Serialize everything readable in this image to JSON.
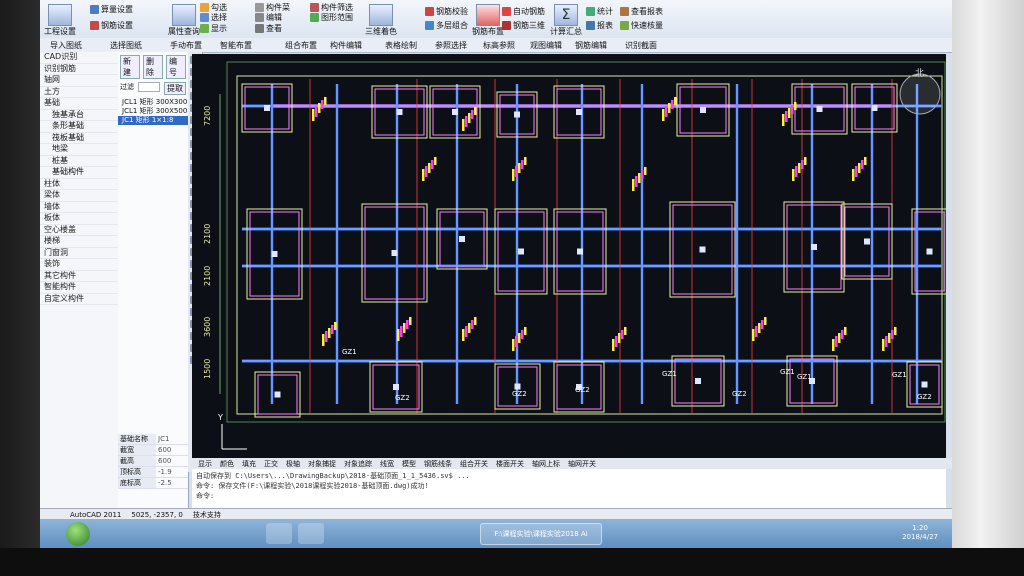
{
  "ribbon": {
    "big_buttons": [
      {
        "label": "工程设置",
        "icon": "project-settings-icon"
      },
      {
        "label": "属性查询",
        "icon": "property-query-icon"
      },
      {
        "label": "三维着色",
        "icon": "3d-shade-icon"
      },
      {
        "label": "钢筋布置",
        "icon": "rebar-place-icon"
      },
      {
        "label": "计算汇总",
        "icon": "sigma-icon"
      }
    ],
    "small_buttons": [
      "算量设置",
      "钢筋设置",
      "勾选",
      "选择",
      "显示",
      "构件菜",
      "编辑",
      "查看",
      "构件筛选",
      "图形范围",
      "隐藏",
      "查询",
      "两份",
      "图层",
      "钢筋校验",
      "智能钢筋",
      "多层组合",
      "自动钢筋",
      "钢筋三维",
      "统计",
      "报表",
      "查看报表",
      "快速核量"
    ],
    "toolbar2": [
      "导入图纸",
      "选择图纸",
      "手动布置",
      "智能布置",
      "组合布置",
      "构件编辑",
      "表格绘制",
      "参照选择",
      "标高参照",
      "观图编辑",
      "钢筋编辑",
      "识别截面"
    ]
  },
  "left_panel": {
    "items": [
      {
        "label": "CAD识别",
        "type": "cat"
      },
      {
        "label": "识别钢筋",
        "type": "cat"
      },
      {
        "label": "轴网",
        "type": "cat"
      },
      {
        "label": "土方",
        "type": "cat"
      },
      {
        "label": "基础",
        "type": "cat"
      },
      {
        "label": "独基承台",
        "type": "item"
      },
      {
        "label": "条形基础",
        "type": "item"
      },
      {
        "label": "筏板基础",
        "type": "item"
      },
      {
        "label": "地梁",
        "type": "item"
      },
      {
        "label": "桩基",
        "type": "item"
      },
      {
        "label": "基础构件",
        "type": "item"
      },
      {
        "label": "柱体",
        "type": "cat"
      },
      {
        "label": "梁体",
        "type": "cat"
      },
      {
        "label": "墙体",
        "type": "cat"
      },
      {
        "label": "板体",
        "type": "cat"
      },
      {
        "label": "空心楼盖",
        "type": "cat"
      },
      {
        "label": "楼梯",
        "type": "cat"
      },
      {
        "label": "门窗洞",
        "type": "cat"
      },
      {
        "label": "装饰",
        "type": "cat"
      },
      {
        "label": "其它构件",
        "type": "cat"
      },
      {
        "label": "智能构件",
        "type": "cat"
      },
      {
        "label": "自定义构件",
        "type": "cat"
      }
    ]
  },
  "mid_panel": {
    "buttons": [
      "新建",
      "删除",
      "编号"
    ],
    "filter_label": "过滤",
    "filter_btn": "提取",
    "rows": [
      {
        "label": "JCL1 矩形 300X300",
        "selected": false
      },
      {
        "label": "JCL1 矩形 300X500",
        "selected": false
      },
      {
        "label": "JC1 矩形 1×1:8",
        "selected": true
      }
    ],
    "props": [
      {
        "k": "基础名称",
        "v": "JC1"
      },
      {
        "k": "截宽",
        "v": "600"
      },
      {
        "k": "截高",
        "v": "600"
      },
      {
        "k": "顶标高",
        "v": "-1.9"
      },
      {
        "k": "底标高",
        "v": "-2.5"
      }
    ]
  },
  "drawing": {
    "dims": [
      "7200",
      "2100",
      "2100",
      "3600",
      "1500"
    ],
    "gz_labels": [
      "GZ1",
      "GZ1",
      "GZ2",
      "GZ2",
      "GZ1",
      "GZ2",
      "GZ2",
      "GZ1",
      "GZ1",
      "GZ2"
    ],
    "compass": "北",
    "ucs": "Y"
  },
  "bottom_tabs": [
    "显示",
    "颜色",
    "填充",
    "正交",
    "极轴",
    "对象捕捉",
    "对象追踪",
    "线宽",
    "模型",
    "钢筋线条",
    "组合开关",
    "楼面开关",
    "轴网上标",
    "轴网开关"
  ],
  "command_lines": [
    "自动保存到 C:\\Users\\...\\DrawingBackup\\2018-基础顶面_1_1_5436.sv$ ...",
    "命令: 保存文件(F:\\课程实验\\2018课程实验2018-基础顶面.dwg)成功!",
    "命令:"
  ],
  "status": {
    "app": "AutoCAD 2011",
    "coords": "5025, -2357, 0",
    "extra": "技术支持"
  },
  "taskbar": {
    "task_title": "F:\\课程实验\\课程实验2018 Ai",
    "time": "1:20",
    "date": "2018/4/27"
  }
}
